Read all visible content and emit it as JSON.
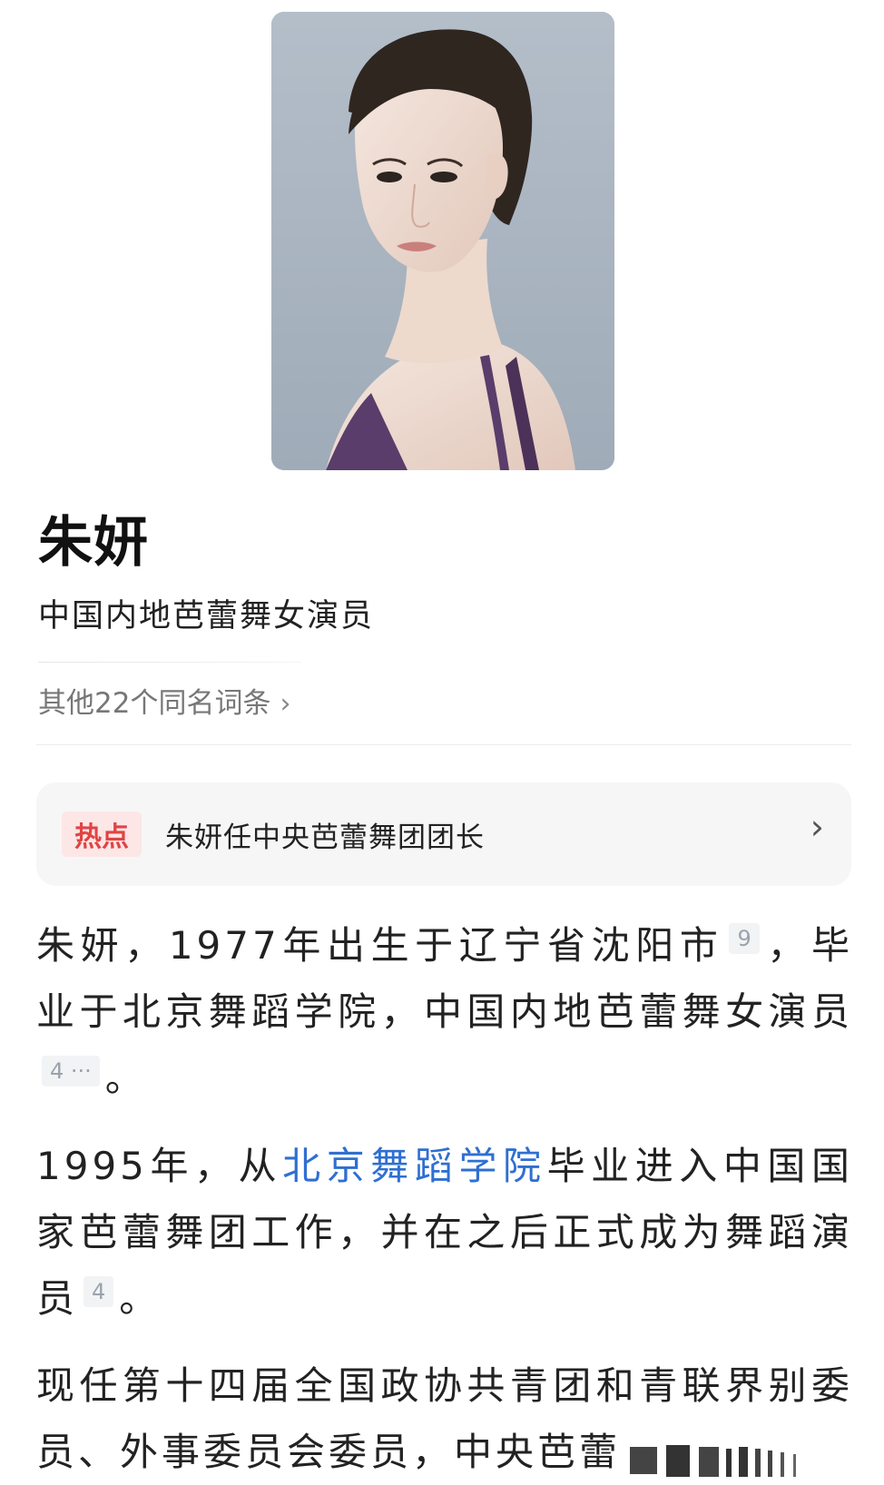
{
  "header": {
    "title": "朱妍",
    "subtitle": "中国内地芭蕾舞女演员",
    "same_name_link": "其他22个同名词条",
    "chevron": "›"
  },
  "hot": {
    "badge": "热点",
    "text": "朱妍任中央芭蕾舞团团长",
    "chevron": "›"
  },
  "paragraphs": {
    "p1": {
      "part1": "朱妍，1977年出生于辽宁省沈阳市",
      "ref1": "9",
      "part2": "，毕业于北京舞蹈学院，中国内地芭蕾舞女演员",
      "ref2": "4 ···",
      "part3": "。"
    },
    "p2": {
      "part1": "1995年，从",
      "link": "北京舞蹈学院",
      "part2": "毕业进入中国国家芭蕾舞团工作，并在之后正式成为舞蹈演员",
      "ref1": "4",
      "part3": "。"
    },
    "p3": {
      "text": "现任第十四届全国政协共青团和青联界别委员、外事委员会委员，中央芭蕾"
    }
  },
  "colors": {
    "link": "#2f6fd1",
    "hot_badge_text": "#e04444",
    "hot_badge_bg": "#fde6e6",
    "card_bg": "#f6f6f6"
  },
  "icons": {
    "chevron": "chevron-right-icon"
  }
}
